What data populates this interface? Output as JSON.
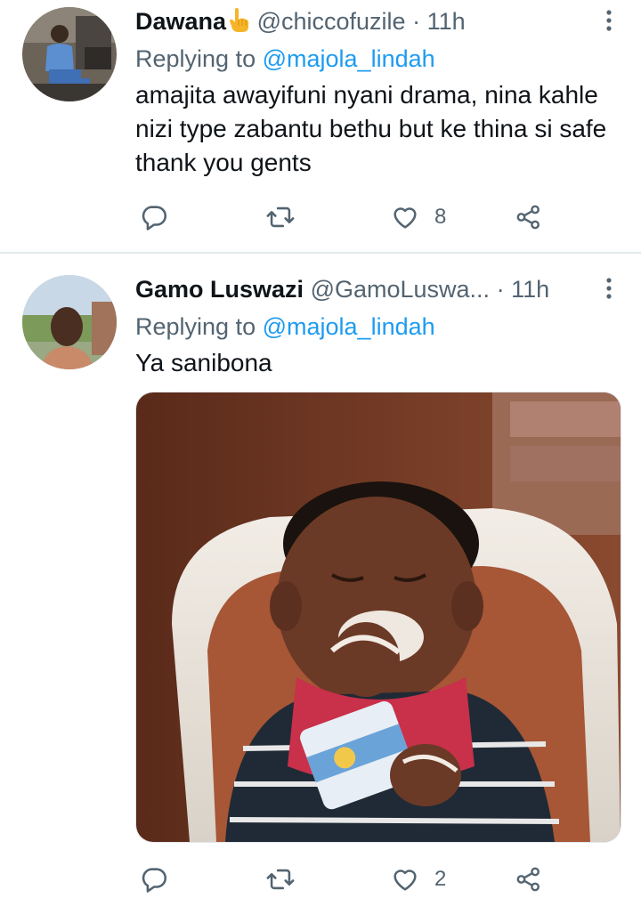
{
  "tweets": [
    {
      "display_name": "Dawana",
      "emoji_icon": "pointing-up-hand-emoji",
      "handle": "@chiccofuzile",
      "separator": "·",
      "time": "11h",
      "replying_prefix": "Replying to",
      "replying_to": "@majola_lindah",
      "text": "amajita awayifuni nyani drama, nina kahle nizi type zabantu bethu but ke thina si safe thank you gents",
      "likes": "8",
      "icons": [
        "reply-icon",
        "retweet-icon",
        "like-icon",
        "share-icon",
        "more-icon"
      ]
    },
    {
      "display_name": "Gamo Luswazi",
      "handle": "@GamoLuswa...",
      "separator": "·",
      "time": "11h",
      "replying_prefix": "Replying to",
      "replying_to": "@majola_lindah",
      "text": "Ya sanibona",
      "likes": "2",
      "icons": [
        "reply-icon",
        "retweet-icon",
        "like-icon",
        "share-icon",
        "more-icon"
      ]
    }
  ],
  "colors": {
    "link": "#1d9bf0",
    "secondary_text": "#536471",
    "primary_text": "#0f1419",
    "divider": "#e3e8ec"
  }
}
